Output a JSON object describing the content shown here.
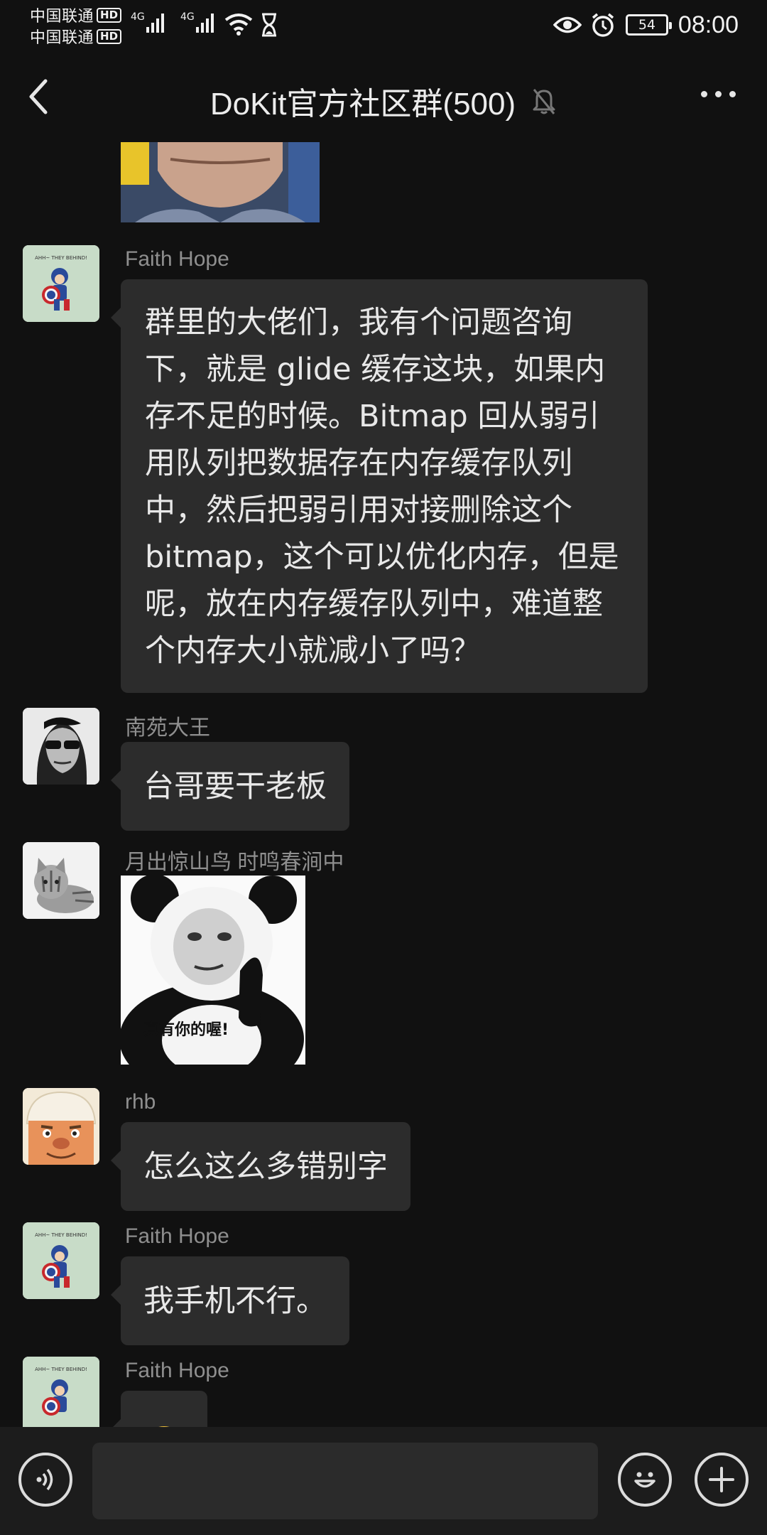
{
  "status_bar": {
    "carrier1": "中国联通",
    "carrier2": "中国联通",
    "hd_badge": "HD",
    "net1": "4G",
    "net2": "4G",
    "battery": "54",
    "time": "08:00"
  },
  "nav": {
    "title": "DoKit官方社区群(500)"
  },
  "messages": [
    {
      "sender": "Faith Hope",
      "avatar": "captain-america-avatar",
      "text": "群里的大佬们，我有个问题咨询下，就是 glide 缓存这块，如果内存不足的时候。Bitmap 回从弱引用队列把数据存在内存缓存队列中，然后把弱引用对接删除这个 bitmap，这个可以优化内存，但是呢，放在内存缓存队列中，难道整个内存大小就减小了吗？"
    },
    {
      "sender": "南苑大王",
      "avatar": "sunglasses-man-avatar",
      "text": "台哥要干老板"
    },
    {
      "sender": "月出惊山鸟  时鸣春涧中",
      "avatar": "cat-avatar",
      "sticker_caption": "真有你的喔!"
    },
    {
      "sender": "rhb",
      "avatar": "cartoon-face-avatar",
      "text": "怎么这么多错别字"
    },
    {
      "sender": "Faith Hope",
      "avatar": "captain-america-avatar",
      "text": "我手机不行。"
    },
    {
      "sender": "Faith Hope",
      "avatar": "captain-america-avatar",
      "text": ""
    }
  ],
  "colors": {
    "background": "#111111",
    "bubble": "#2c2c2c",
    "sender": "#8f8f8f",
    "text": "#e8e8e8"
  }
}
